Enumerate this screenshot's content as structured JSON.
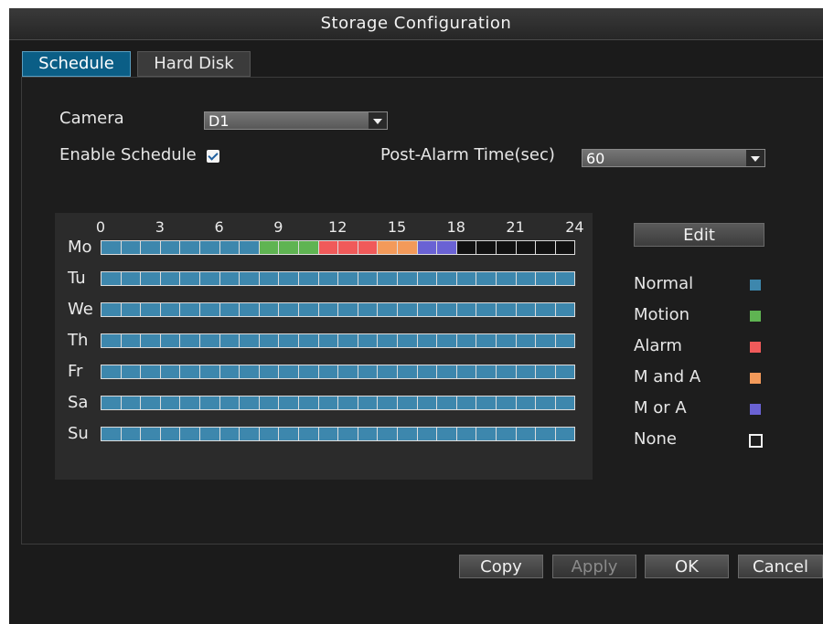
{
  "window": {
    "title": "Storage Configuration"
  },
  "tabs": [
    {
      "label": "Schedule",
      "active": true
    },
    {
      "label": "Hard Disk",
      "active": false
    }
  ],
  "form": {
    "camera_label": "Camera",
    "camera_value": "D1",
    "enable_schedule_label": "Enable Schedule",
    "enable_schedule_checked": true,
    "post_alarm_label": "Post-Alarm Time(sec)",
    "post_alarm_value": "60"
  },
  "schedule": {
    "hour_ticks": [
      "0",
      "3",
      "6",
      "9",
      "12",
      "15",
      "18",
      "21",
      "24"
    ],
    "days": [
      {
        "label": "Mo",
        "slots": [
          "normal",
          "normal",
          "normal",
          "normal",
          "normal",
          "normal",
          "normal",
          "normal",
          "motion",
          "motion",
          "motion",
          "alarm",
          "alarm",
          "alarm",
          "m_and_a",
          "m_and_a",
          "m_or_a",
          "m_or_a",
          "none",
          "none",
          "none",
          "none",
          "none",
          "none"
        ]
      },
      {
        "label": "Tu",
        "slots": [
          "normal",
          "normal",
          "normal",
          "normal",
          "normal",
          "normal",
          "normal",
          "normal",
          "normal",
          "normal",
          "normal",
          "normal",
          "normal",
          "normal",
          "normal",
          "normal",
          "normal",
          "normal",
          "normal",
          "normal",
          "normal",
          "normal",
          "normal",
          "normal"
        ]
      },
      {
        "label": "We",
        "slots": [
          "normal",
          "normal",
          "normal",
          "normal",
          "normal",
          "normal",
          "normal",
          "normal",
          "normal",
          "normal",
          "normal",
          "normal",
          "normal",
          "normal",
          "normal",
          "normal",
          "normal",
          "normal",
          "normal",
          "normal",
          "normal",
          "normal",
          "normal",
          "normal"
        ]
      },
      {
        "label": "Th",
        "slots": [
          "normal",
          "normal",
          "normal",
          "normal",
          "normal",
          "normal",
          "normal",
          "normal",
          "normal",
          "normal",
          "normal",
          "normal",
          "normal",
          "normal",
          "normal",
          "normal",
          "normal",
          "normal",
          "normal",
          "normal",
          "normal",
          "normal",
          "normal",
          "normal"
        ]
      },
      {
        "label": "Fr",
        "slots": [
          "normal",
          "normal",
          "normal",
          "normal",
          "normal",
          "normal",
          "normal",
          "normal",
          "normal",
          "normal",
          "normal",
          "normal",
          "normal",
          "normal",
          "normal",
          "normal",
          "normal",
          "normal",
          "normal",
          "normal",
          "normal",
          "normal",
          "normal",
          "normal"
        ]
      },
      {
        "label": "Sa",
        "slots": [
          "normal",
          "normal",
          "normal",
          "normal",
          "normal",
          "normal",
          "normal",
          "normal",
          "normal",
          "normal",
          "normal",
          "normal",
          "normal",
          "normal",
          "normal",
          "normal",
          "normal",
          "normal",
          "normal",
          "normal",
          "normal",
          "normal",
          "normal",
          "normal"
        ]
      },
      {
        "label": "Su",
        "slots": [
          "normal",
          "normal",
          "normal",
          "normal",
          "normal",
          "normal",
          "normal",
          "normal",
          "normal",
          "normal",
          "normal",
          "normal",
          "normal",
          "normal",
          "normal",
          "normal",
          "normal",
          "normal",
          "normal",
          "normal",
          "normal",
          "normal",
          "normal",
          "normal"
        ]
      }
    ]
  },
  "edit_button": "Edit",
  "legend": [
    {
      "key": "normal",
      "label": "Normal",
      "color": "#3d87ad"
    },
    {
      "key": "motion",
      "label": "Motion",
      "color": "#5fb452"
    },
    {
      "key": "alarm",
      "label": "Alarm",
      "color": "#f05a5a"
    },
    {
      "key": "m_and_a",
      "label": "M and A",
      "color": "#f39a5a"
    },
    {
      "key": "m_or_a",
      "label": "M or A",
      "color": "#6a62d4"
    },
    {
      "key": "none",
      "label": "None",
      "color": "transparent"
    }
  ],
  "footer": {
    "copy": "Copy",
    "apply": "Apply",
    "ok": "OK",
    "cancel": "Cancel"
  }
}
